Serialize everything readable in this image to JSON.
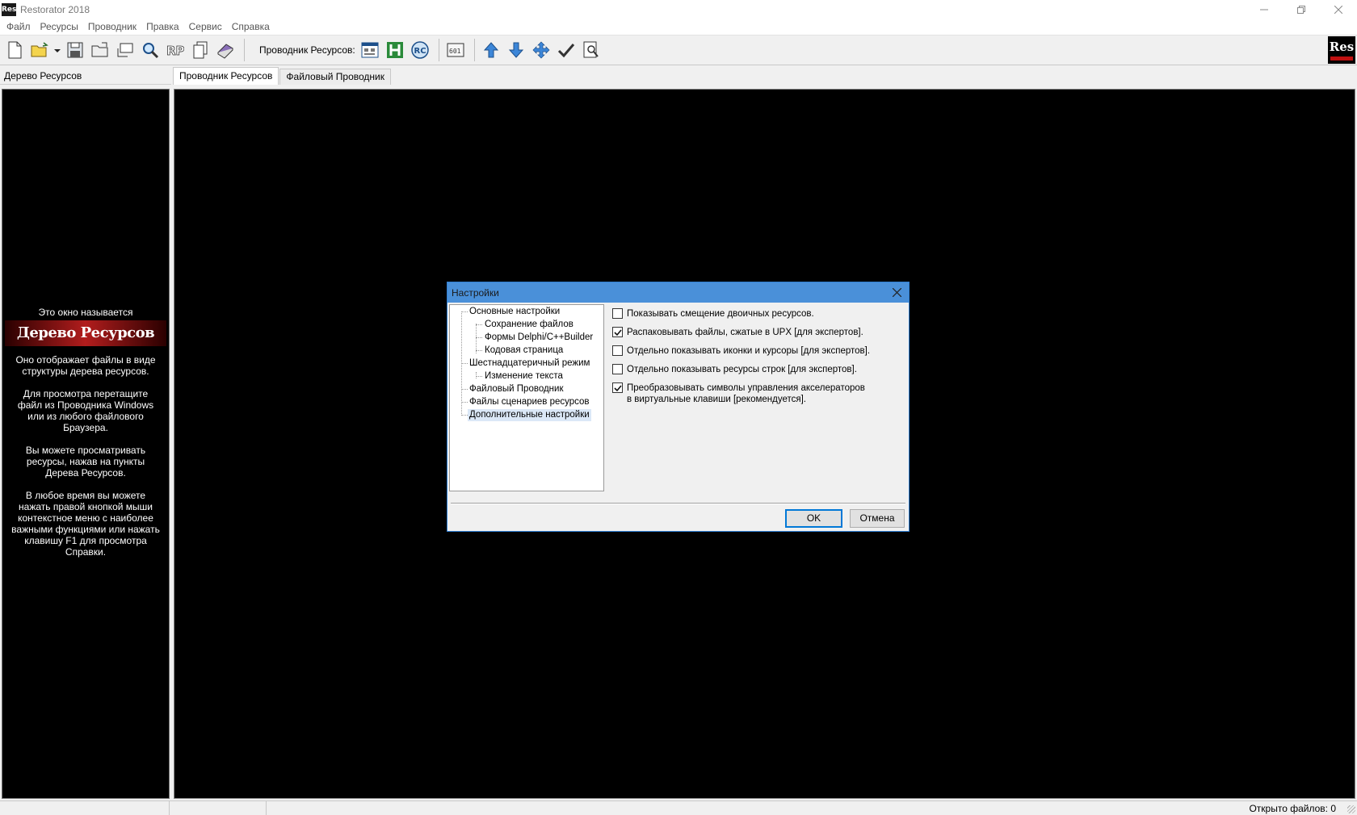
{
  "window": {
    "title": "Restorator 2018",
    "app_icon_text": "Res"
  },
  "menu": [
    "Файл",
    "Ресурсы",
    "Проводник",
    "Правка",
    "Сервис",
    "Справка"
  ],
  "toolbar": {
    "explorer_label": "Проводник Ресурсов:",
    "logo_text": "Res"
  },
  "tree_header": "Дерево Ресурсов",
  "tabs": [
    "Проводник Ресурсов",
    "Файловый Проводник"
  ],
  "tree_info": {
    "caption": "Это окно называется",
    "banner": "Дерево Ресурсов",
    "p1": "Оно отображает файлы в виде структуры дерева ресурсов.",
    "p2": "Для просмотра перетащите файл из Проводника Windows или из любого файлового Браузера.",
    "p3": "Вы можете просматривать ресурсы, нажав на пункты Дерева Ресурсов.",
    "p4": "В любое время вы можете нажать правой кнопкой мыши контекстное меню с наиболее важными функциями или нажать клавишу F1 для просмотра Справки."
  },
  "dialog": {
    "title": "Настройки",
    "tree": [
      {
        "label": "Основные настройки",
        "level": 0
      },
      {
        "label": "Сохранение файлов",
        "level": 1
      },
      {
        "label": "Формы Delphi/C++Builder",
        "level": 1
      },
      {
        "label": "Кодовая страница",
        "level": 1
      },
      {
        "label": "Шестнадцатеричный режим",
        "level": 0
      },
      {
        "label": "Изменение текста",
        "level": 1
      },
      {
        "label": "Файловый Проводник",
        "level": 0
      },
      {
        "label": "Файлы сценариев ресурсов",
        "level": 0
      },
      {
        "label": "Дополнительные настройки",
        "level": 0,
        "selected": true
      }
    ],
    "options": [
      {
        "label": "Показывать смещение двоичных ресурсов.",
        "checked": false
      },
      {
        "label": "Распаковывать файлы, сжатые в UPX [для экспертов].",
        "checked": true
      },
      {
        "label": "Отдельно показывать иконки и курсоры [для экспертов].",
        "checked": false
      },
      {
        "label": "Отдельно показывать ресурсы строк [для экспертов].",
        "checked": false
      },
      {
        "label": "Преобразовывать символы управления акселераторов в виртуальные клавиши [рекомендуется].",
        "checked": true
      }
    ],
    "ok_label": "OK",
    "cancel_label": "Отмена"
  },
  "status": {
    "open_files": "Открыто файлов: 0"
  }
}
